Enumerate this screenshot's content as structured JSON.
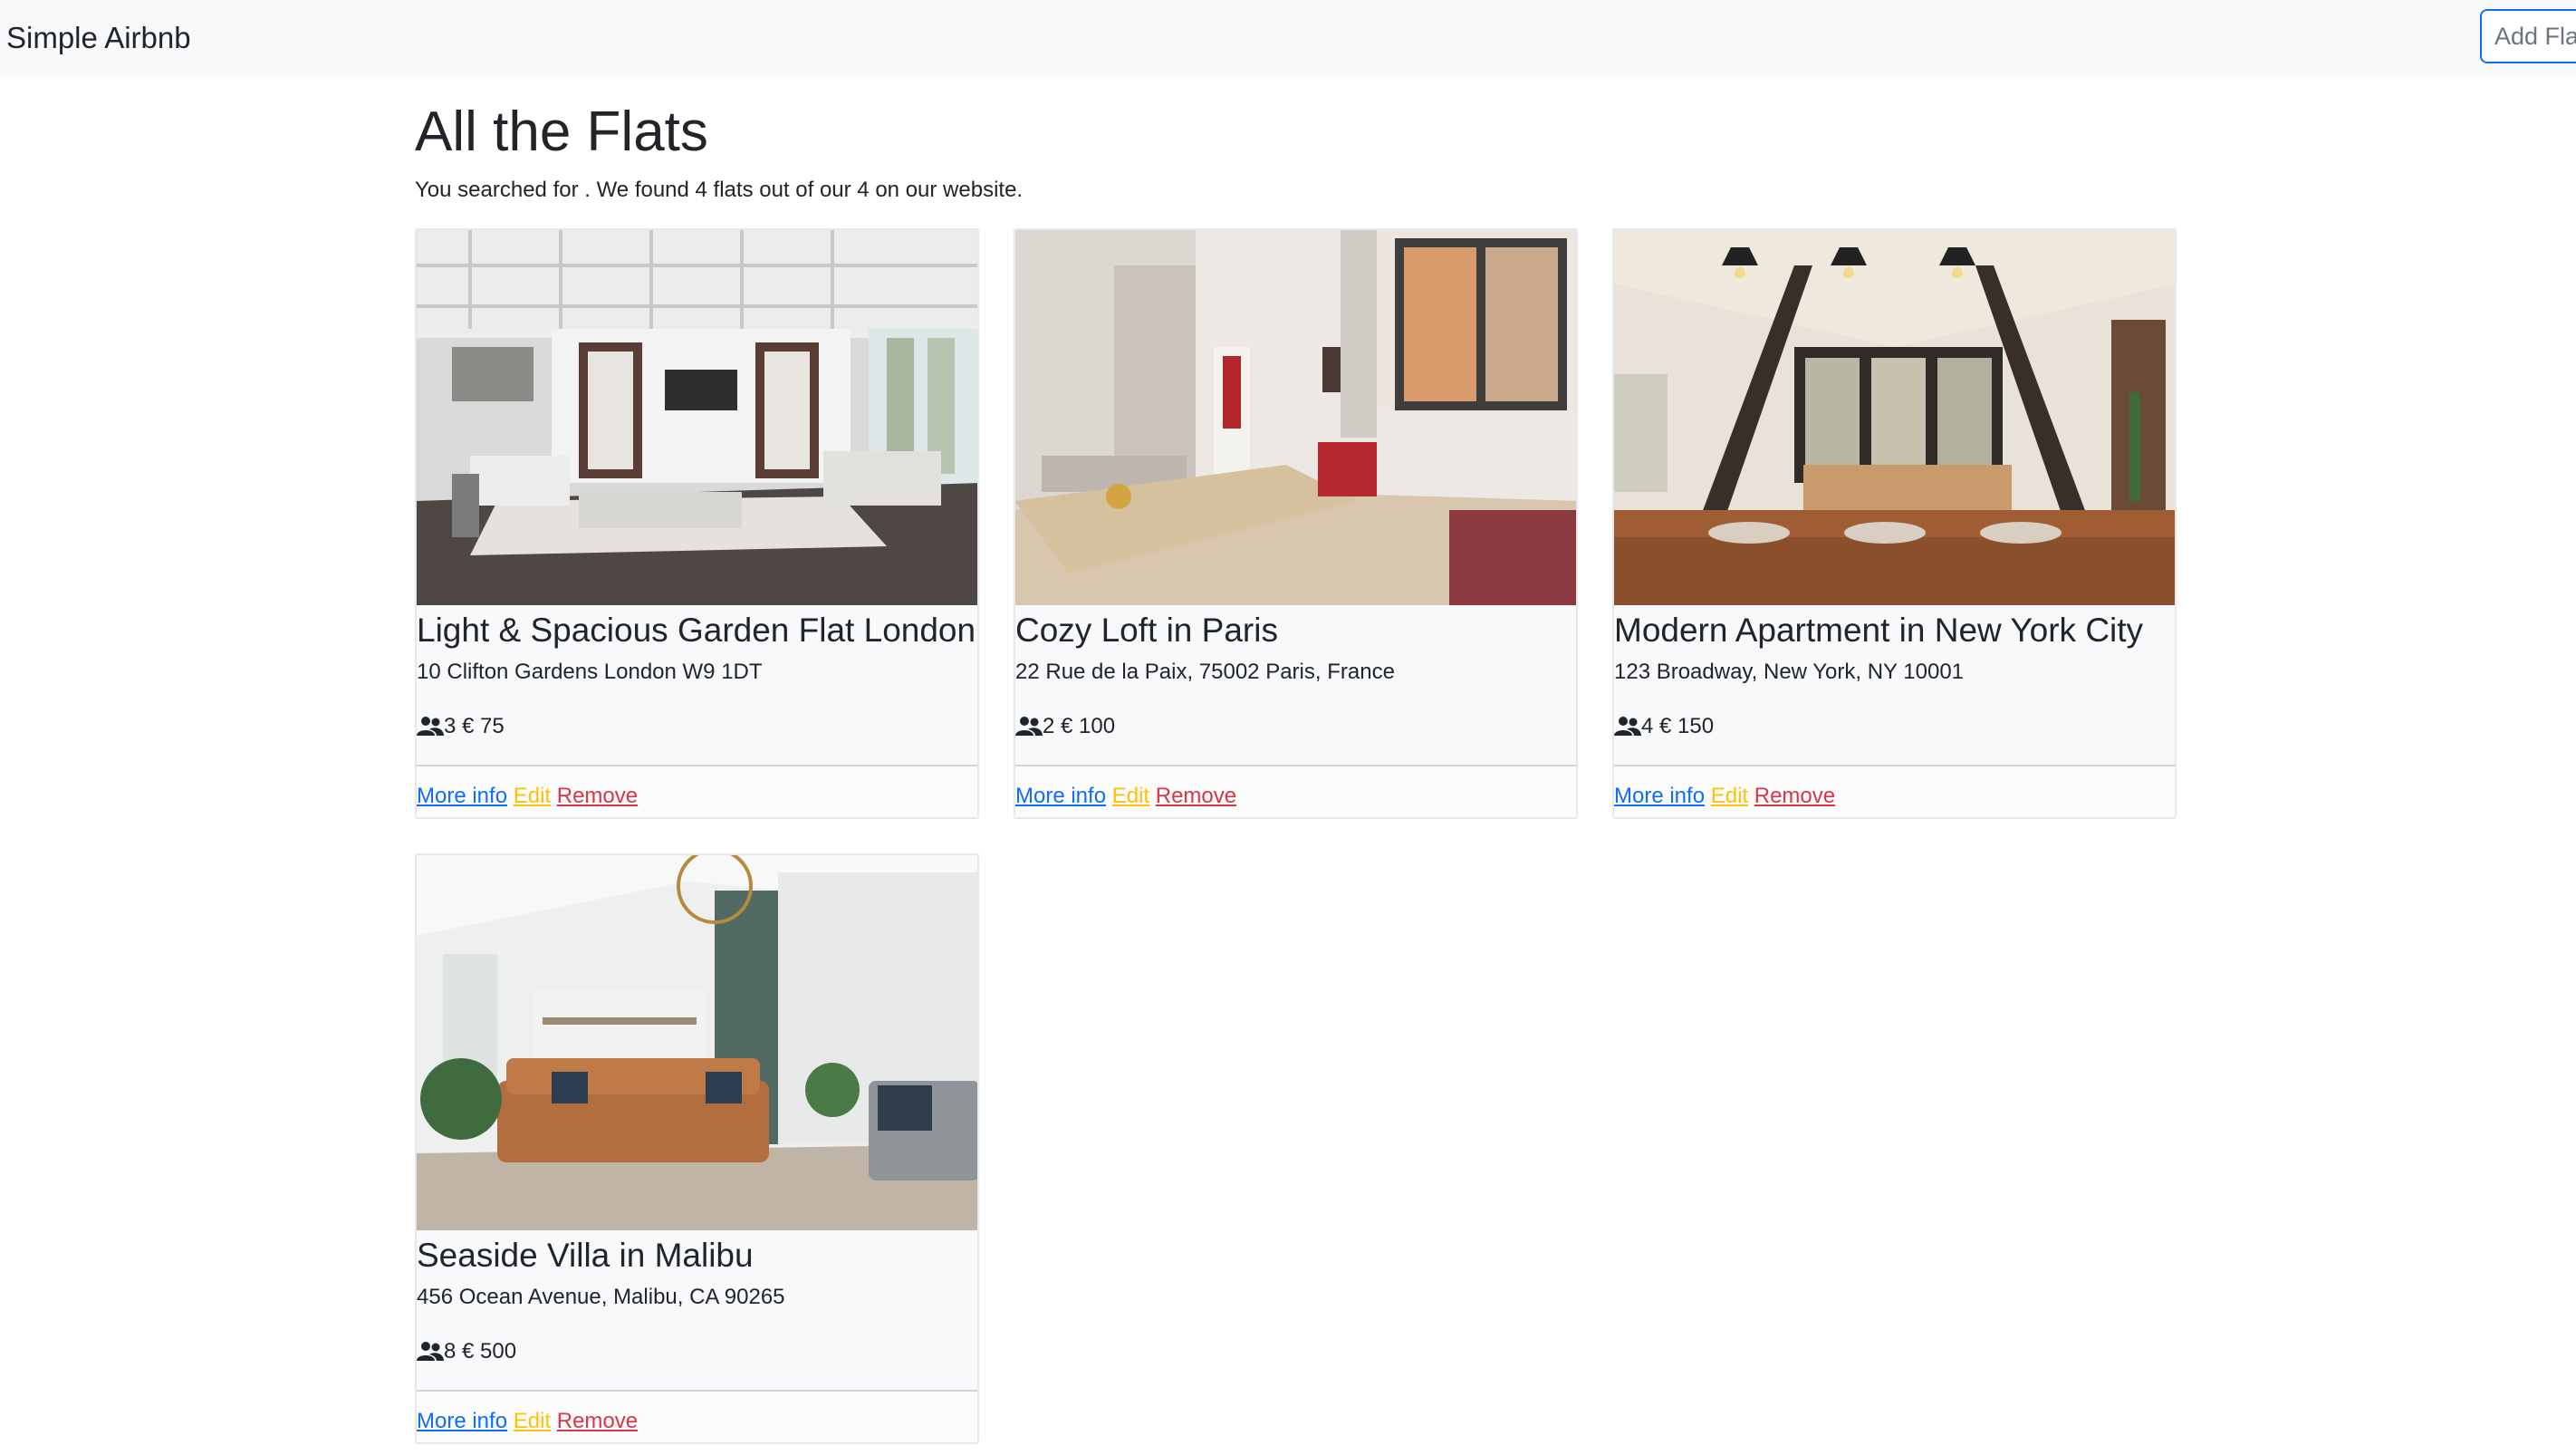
{
  "navbar": {
    "brand": "Simple Airbnb",
    "add_flat_label": "Add Flat"
  },
  "header": {
    "title": "All the Flats",
    "summary": "You searched for . We found 4 flats out of our 4 on our website."
  },
  "flats": [
    {
      "name": "Light & Spacious Garden Flat London",
      "address": "10 Clifton Gardens London W9 1DT",
      "guests": "3",
      "price": "€ 75",
      "more_info": "More info",
      "edit": "Edit",
      "remove": "Remove"
    },
    {
      "name": "Cozy Loft in Paris",
      "address": "22 Rue de la Paix, 75002 Paris, France",
      "guests": "2",
      "price": "€ 100",
      "more_info": "More info",
      "edit": "Edit",
      "remove": "Remove"
    },
    {
      "name": "Modern Apartment in New York City",
      "address": "123 Broadway, New York, NY 10001",
      "guests": "4",
      "price": "€ 150",
      "more_info": "More info",
      "edit": "Edit",
      "remove": "Remove"
    },
    {
      "name": "Seaside Villa in Malibu",
      "address": "456 Ocean Avenue, Malibu, CA 90265",
      "guests": "8",
      "price": "€ 500",
      "more_info": "More info",
      "edit": "Edit",
      "remove": "Remove"
    }
  ],
  "colors": {
    "navbar_bg": "#f8f9fa",
    "link_primary": "#0d6efd",
    "link_warning": "#ffc107",
    "link_danger": "#dc3545"
  },
  "icons": {
    "guests": "people-icon"
  }
}
